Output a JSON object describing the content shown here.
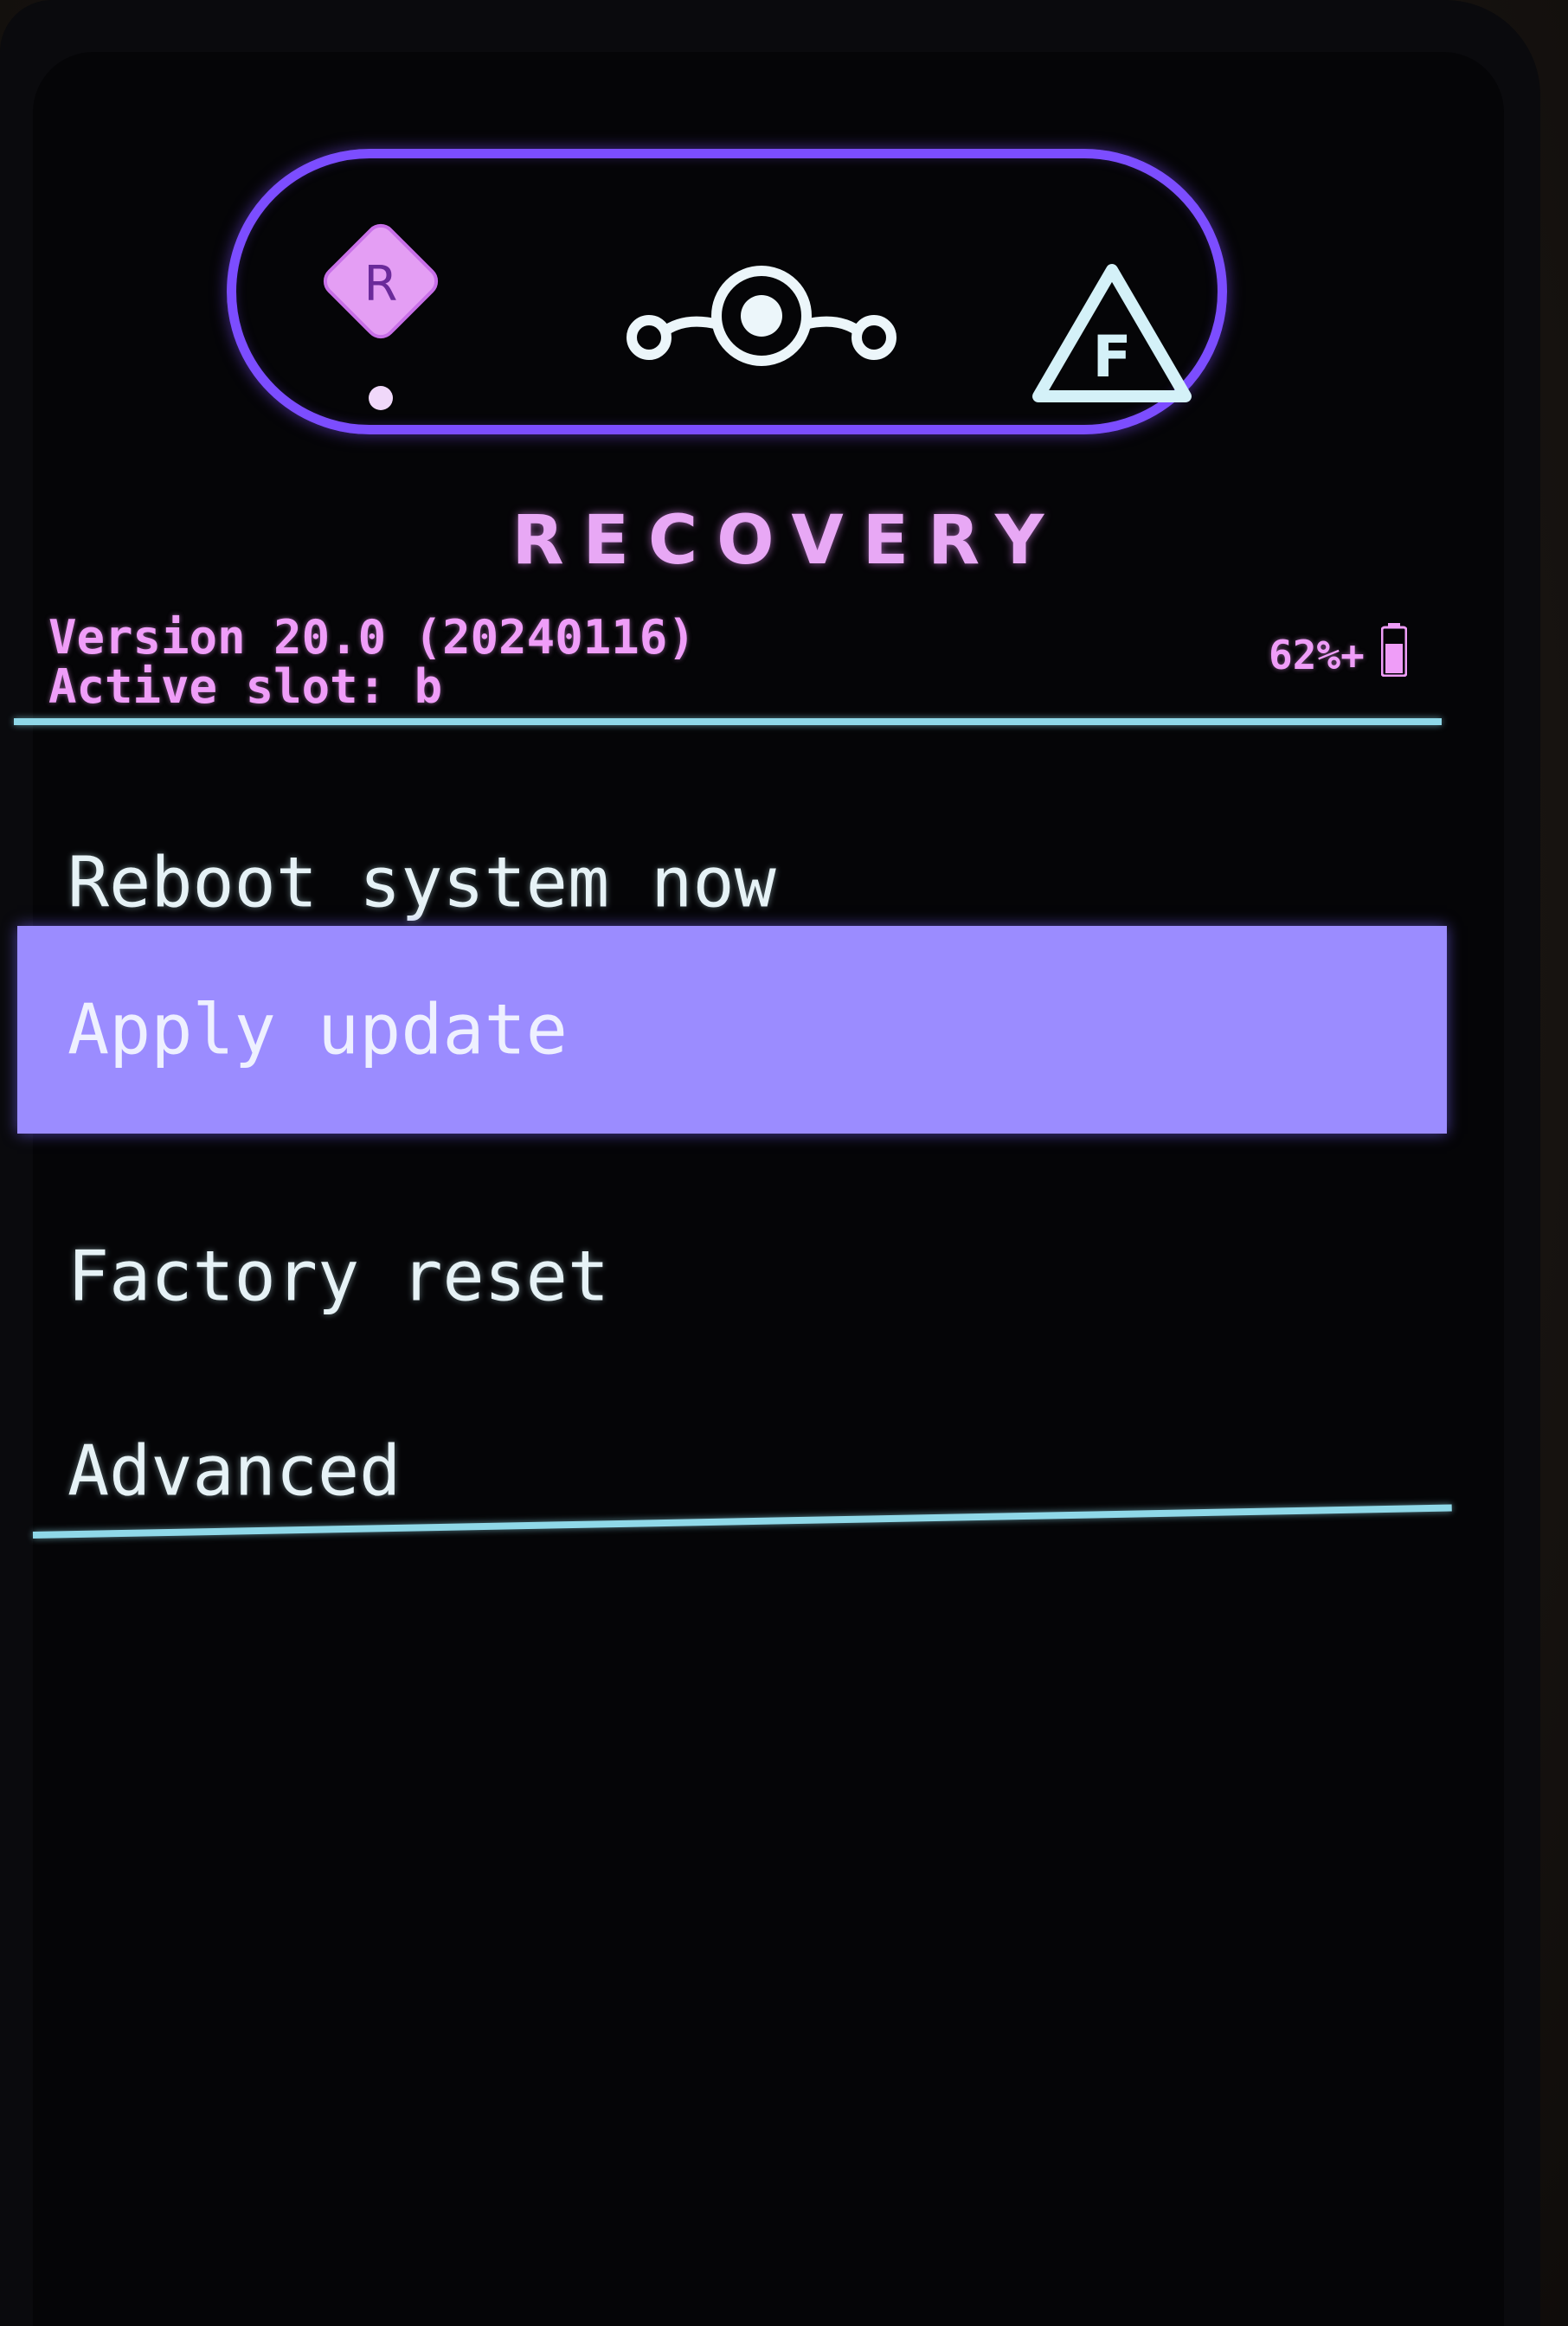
{
  "header": {
    "title": "RECOVERY",
    "version": "Version 20.0 (20240116)",
    "active_slot": "Active slot: b",
    "battery": "62%+"
  },
  "logo": {
    "left_icon_letter": "R",
    "right_icon_letter": "F",
    "icons": [
      "recovery-diamond-icon",
      "lineage-logo-icon",
      "fastboot-warning-icon",
      "battery-icon"
    ]
  },
  "menu": {
    "items": [
      {
        "label": "Reboot system now"
      },
      {
        "label": "Apply update"
      },
      {
        "label": "Factory reset"
      },
      {
        "label": "Advanced"
      }
    ],
    "selected": "Apply update"
  },
  "colors": {
    "accent_purple": "#7c4dff",
    "highlight": "#9b8cff",
    "text_pink": "#ef9df8",
    "divider_cyan": "#8fd8e8",
    "menu_text": "#e6f2f6",
    "background": "#050507"
  }
}
